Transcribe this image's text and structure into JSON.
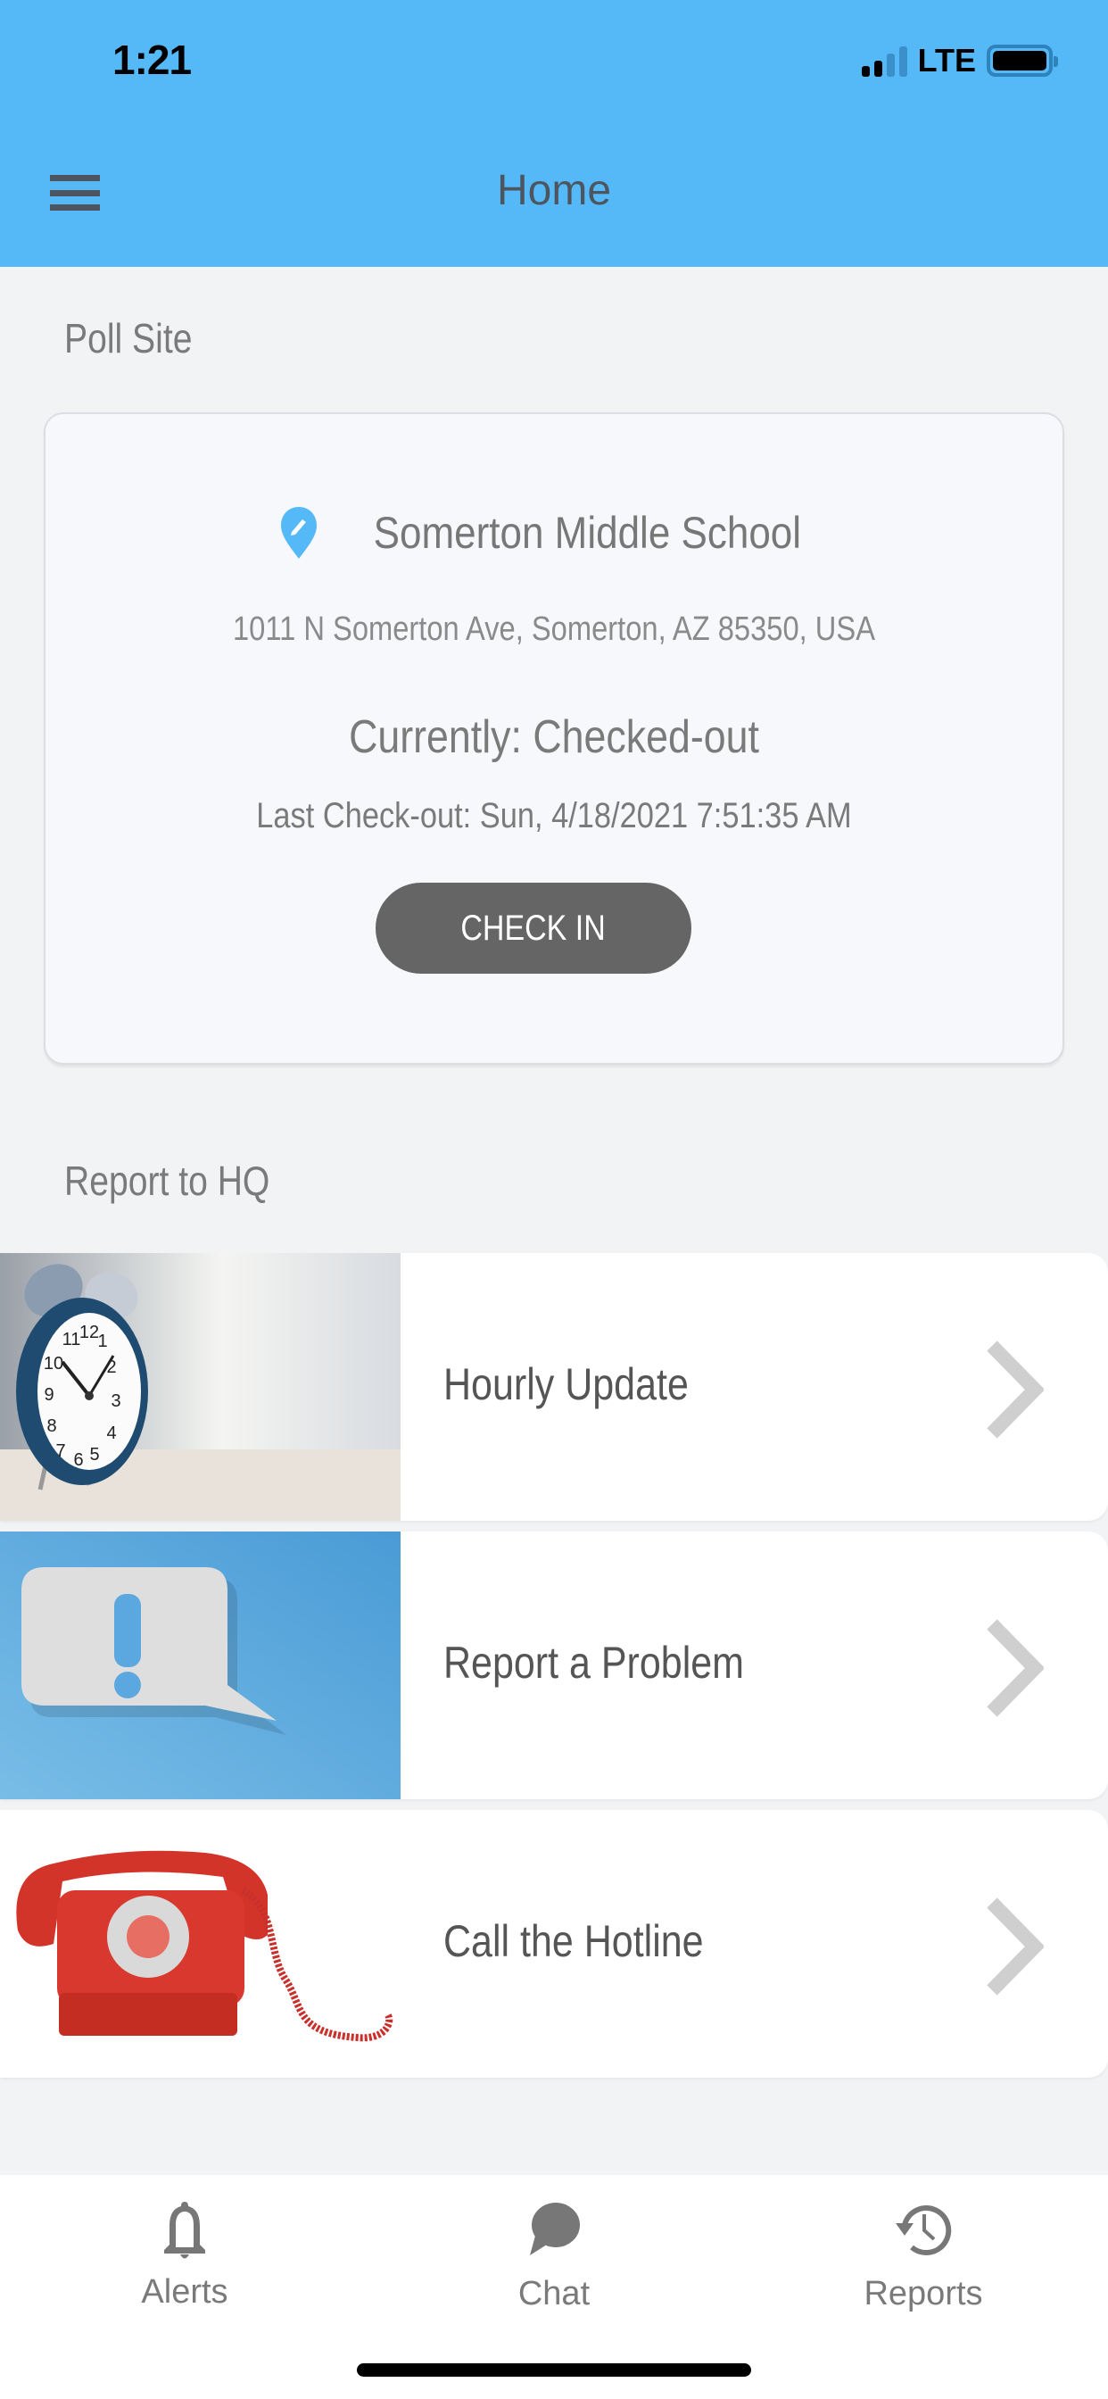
{
  "status_bar": {
    "time": "1:21",
    "network": "LTE",
    "signal_bars_active": 2,
    "signal_bars_total": 4
  },
  "header": {
    "title": "Home",
    "menu_icon": "hamburger-menu-icon",
    "background_color": "#55b9f7"
  },
  "poll_site": {
    "section_title": "Poll Site",
    "site_icon": "map-pin-edit-icon",
    "site_name": "Somerton Middle School",
    "address": "1011 N Somerton Ave, Somerton, AZ 85350, USA",
    "status": "Currently: Checked-out",
    "last_checkout": "Last Check-out: Sun, 4/18/2021 7:51:35 AM",
    "check_in_label": "CHECK IN"
  },
  "report_to_hq": {
    "section_title": "Report to HQ",
    "items": [
      {
        "label": "Hourly Update",
        "image": "alarm-clock-image",
        "chevron": "chevron-right-icon"
      },
      {
        "label": "Report a Problem",
        "image": "exclamation-speech-bubble-image",
        "chevron": "chevron-right-icon"
      },
      {
        "label": "Call the Hotline",
        "image": "red-rotary-telephone-image",
        "chevron": "chevron-right-icon"
      }
    ]
  },
  "tab_bar": {
    "tabs": [
      {
        "label": "Alerts",
        "icon": "bell-icon"
      },
      {
        "label": "Chat",
        "icon": "chat-bubble-icon"
      },
      {
        "label": "Reports",
        "icon": "history-icon"
      }
    ]
  }
}
